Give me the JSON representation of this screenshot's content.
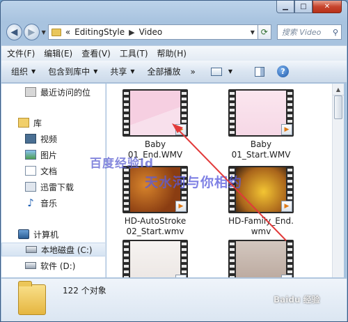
{
  "breadcrumb": {
    "overflow": "«",
    "parent": "EditingStyle",
    "current": "Video"
  },
  "search": {
    "placeholder": "搜索 Video"
  },
  "menu": [
    "文件(F)",
    "编辑(E)",
    "查看(V)",
    "工具(T)",
    "帮助(H)"
  ],
  "toolbar": {
    "organize": "组织",
    "include_library": "包含到库中",
    "share": "共享",
    "play_all": "全部播放",
    "more": "»"
  },
  "nav": {
    "recent": "最近访问的位",
    "library": "库",
    "videos": "视频",
    "pictures": "图片",
    "documents": "文档",
    "thunder": "迅雷下载",
    "music": "音乐",
    "computer": "计算机",
    "local_c": "本地磁盘 (C:)",
    "soft_d": "软件 (D:)"
  },
  "files": [
    {
      "name": "Baby\n01_End.WMV"
    },
    {
      "name": "Baby\n01_Start.WMV"
    },
    {
      "name": "HD-AutoStroke\n02_Start.wmv"
    },
    {
      "name": "HD-Family_End.\nwmv"
    },
    {
      "name": ""
    },
    {
      "name": ""
    }
  ],
  "status": {
    "count": "122 个对象"
  },
  "watermark": {
    "line1": "百度经验ld",
    "line2": "天水河与你相约",
    "line3": "Baidu 经验"
  },
  "colors": {
    "arrow": "#e23a3a",
    "accent": "#1c56a7"
  }
}
